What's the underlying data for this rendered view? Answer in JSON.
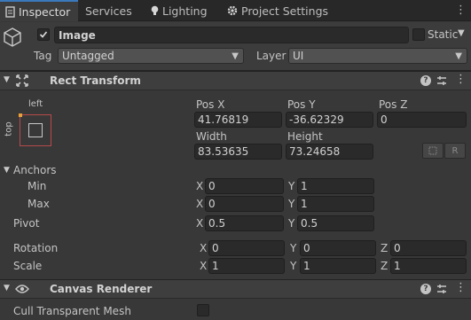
{
  "tabs": [
    {
      "label": "Inspector",
      "icon": "inspector-icon"
    },
    {
      "label": "Services",
      "icon": "services-icon"
    },
    {
      "label": "Lighting",
      "icon": "lightbulb-icon"
    },
    {
      "label": "Project Settings",
      "icon": "gear-icon"
    }
  ],
  "header": {
    "object_name": "Image",
    "active": true,
    "static_label": "Static",
    "tag_label": "Tag",
    "tag_value": "Untagged",
    "layer_label": "Layer",
    "layer_value": "UI"
  },
  "rect_transform": {
    "title": "Rect Transform",
    "anchor_h": "left",
    "anchor_v": "top",
    "pos_x_label": "Pos X",
    "pos_x": "41.76819",
    "pos_y_label": "Pos Y",
    "pos_y": "-36.62329",
    "pos_z_label": "Pos Z",
    "pos_z": "0",
    "width_label": "Width",
    "width": "83.53635",
    "height_label": "Height",
    "height": "73.24658",
    "raw_edit_label": "R",
    "anchors_label": "Anchors",
    "min_label": "Min",
    "min_x": "0",
    "min_y": "1",
    "max_label": "Max",
    "max_x": "0",
    "max_y": "1",
    "pivot_label": "Pivot",
    "pivot_x": "0.5",
    "pivot_y": "0.5",
    "rotation_label": "Rotation",
    "rot_x": "0",
    "rot_y": "0",
    "rot_z": "0",
    "scale_label": "Scale",
    "scale_x": "1",
    "scale_y": "1",
    "scale_z": "1",
    "x": "X",
    "y": "Y",
    "z": "Z"
  },
  "canvas_renderer": {
    "title": "Canvas Renderer",
    "cull_label": "Cull Transparent Mesh",
    "cull_value": false
  },
  "colors": {
    "accent": "#3a79bb",
    "background": "#383838",
    "field": "#2a2a2a"
  }
}
